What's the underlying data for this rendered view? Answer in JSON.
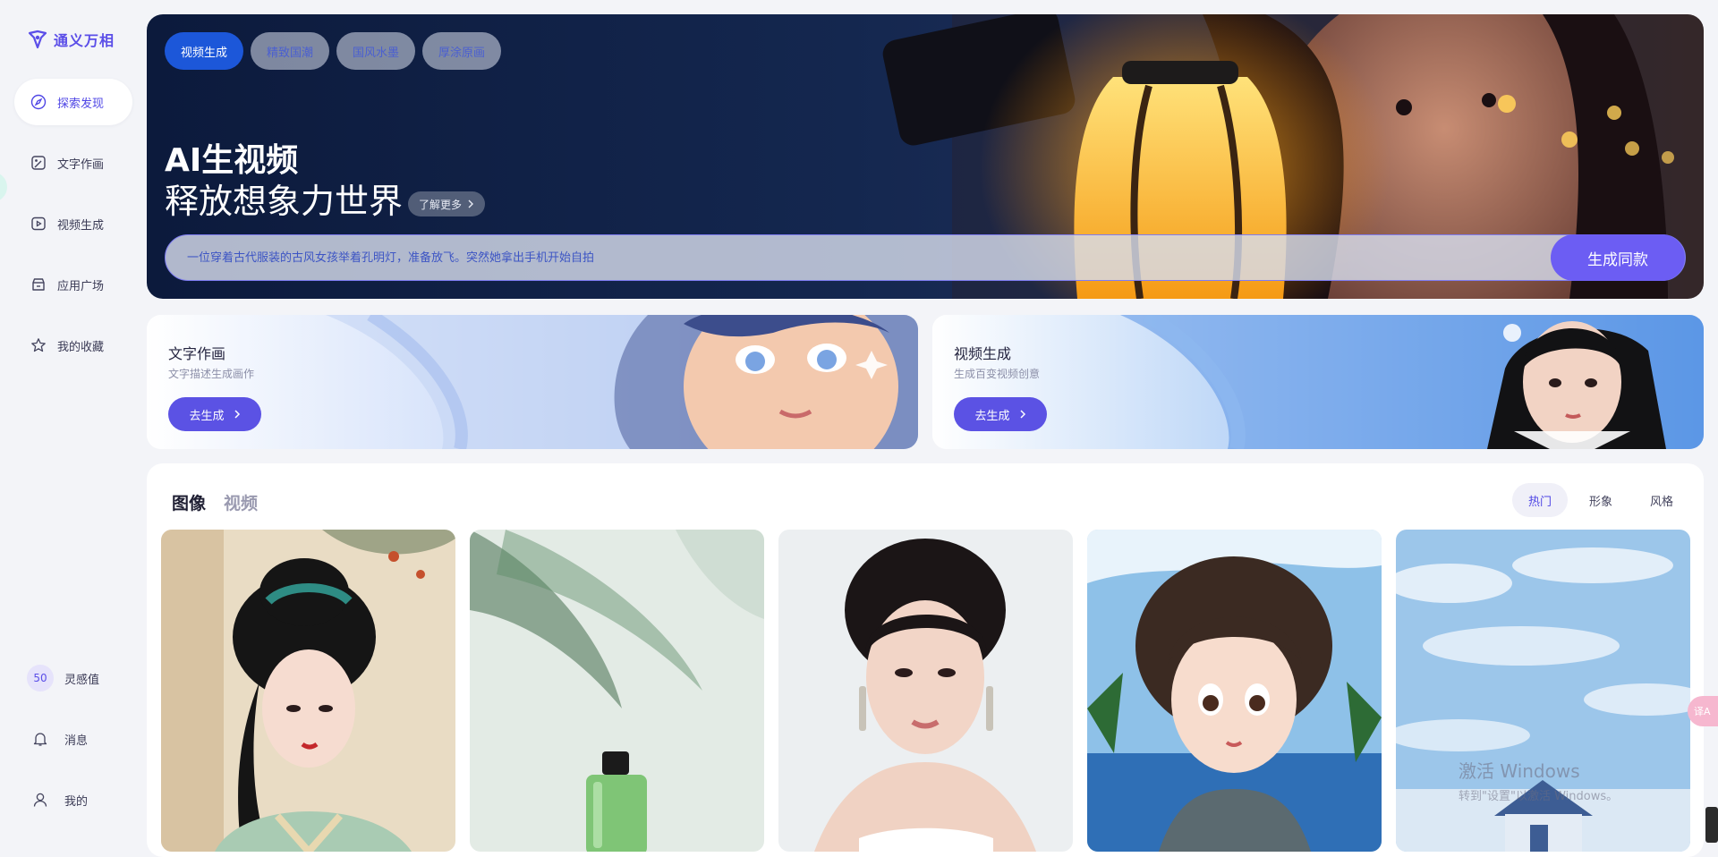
{
  "app": {
    "brand": "通义万相"
  },
  "sidebar": {
    "items": [
      {
        "label": "探索发现",
        "icon": "compass-icon",
        "active": true
      },
      {
        "label": "文字作画",
        "icon": "image-edit-icon",
        "active": false
      },
      {
        "label": "视频生成",
        "icon": "video-play-icon",
        "active": false
      },
      {
        "label": "应用广场",
        "icon": "app-store-icon",
        "active": false
      },
      {
        "label": "我的收藏",
        "icon": "star-icon",
        "active": false
      }
    ],
    "bottom": {
      "credits": {
        "value": "50",
        "label": "灵感值"
      },
      "messages": {
        "label": "消息",
        "icon": "bell-icon"
      },
      "profile": {
        "label": "我的",
        "icon": "user-icon"
      }
    }
  },
  "hero": {
    "tabs": [
      {
        "label": "视频生成",
        "active": true
      },
      {
        "label": "精致国潮",
        "active": false
      },
      {
        "label": "国风水墨",
        "active": false
      },
      {
        "label": "厚涂原画",
        "active": false
      }
    ],
    "title": "AI生视频",
    "subtitle": "释放想象力世界",
    "learn_more": "了解更多",
    "prompt": "一位穿着古代服装的古风女孩举着孔明灯，准备放飞。突然她拿出手机开始自拍",
    "generate_label": "生成同款"
  },
  "cards": [
    {
      "title": "文字作画",
      "desc": "文字描述生成画作",
      "button": "去生成"
    },
    {
      "title": "视频生成",
      "desc": "生成百变视频创意",
      "button": "去生成"
    }
  ],
  "gallery": {
    "tabs": [
      {
        "label": "图像",
        "active": true
      },
      {
        "label": "视频",
        "active": false
      }
    ],
    "filters": [
      {
        "label": "热门",
        "active": true
      },
      {
        "label": "形象",
        "active": false
      },
      {
        "label": "风格",
        "active": false
      }
    ]
  },
  "system": {
    "watermark_line1": "激活 Windows",
    "watermark_line2": "转到\"设置\"以激活 Windows。",
    "translate_label": "译A"
  },
  "colors": {
    "accent": "#5b4ee8",
    "hero_active_tab": "#1c57d9",
    "generate_button": "#6c5df3"
  }
}
